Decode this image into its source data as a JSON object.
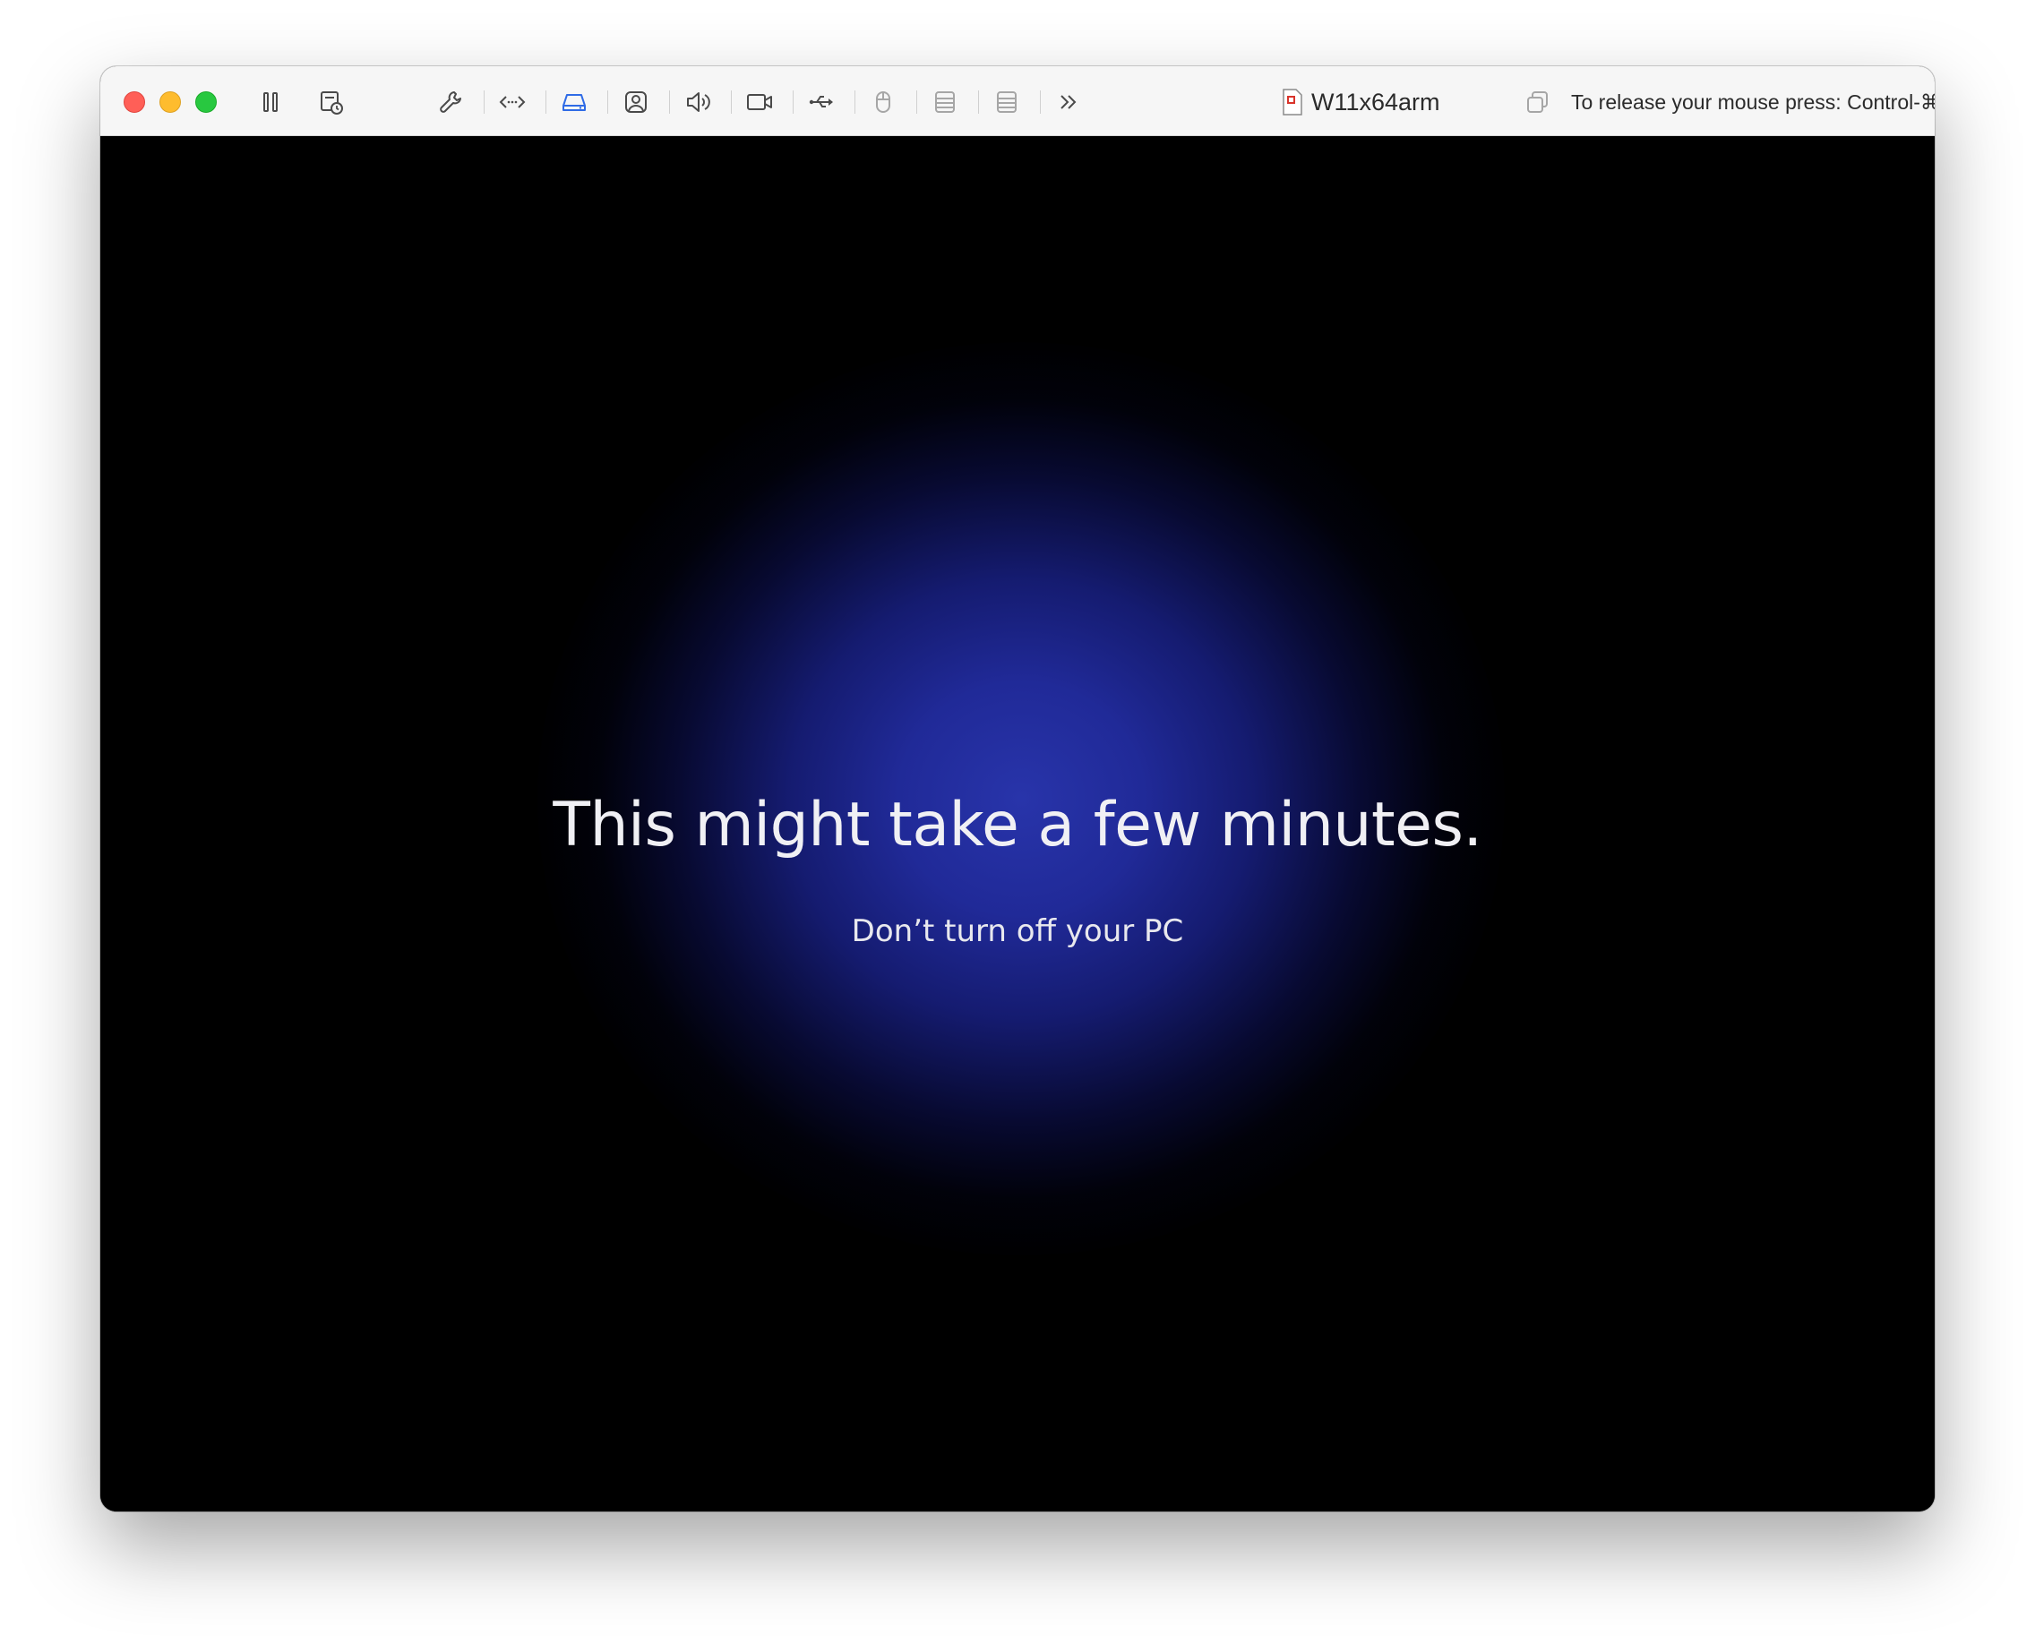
{
  "toolbar": {
    "icons": [
      "pause-icon",
      "snapshot-icon",
      "wrench-icon",
      "code-arrows-icon",
      "disk-icon",
      "user-icon",
      "speaker-icon",
      "camera-icon",
      "usb-icon",
      "mouse-icon",
      "list-icon",
      "list-icon",
      "more-chevron-icon"
    ],
    "vm_name": "W11x64arm",
    "release_hint": "To release your mouse press: Control-⌘",
    "accent_color": "#2f6be6"
  },
  "screen": {
    "headline": "This might take a few minutes.",
    "subline": "Don’t turn off your PC",
    "glow_color": "#2834aa"
  }
}
